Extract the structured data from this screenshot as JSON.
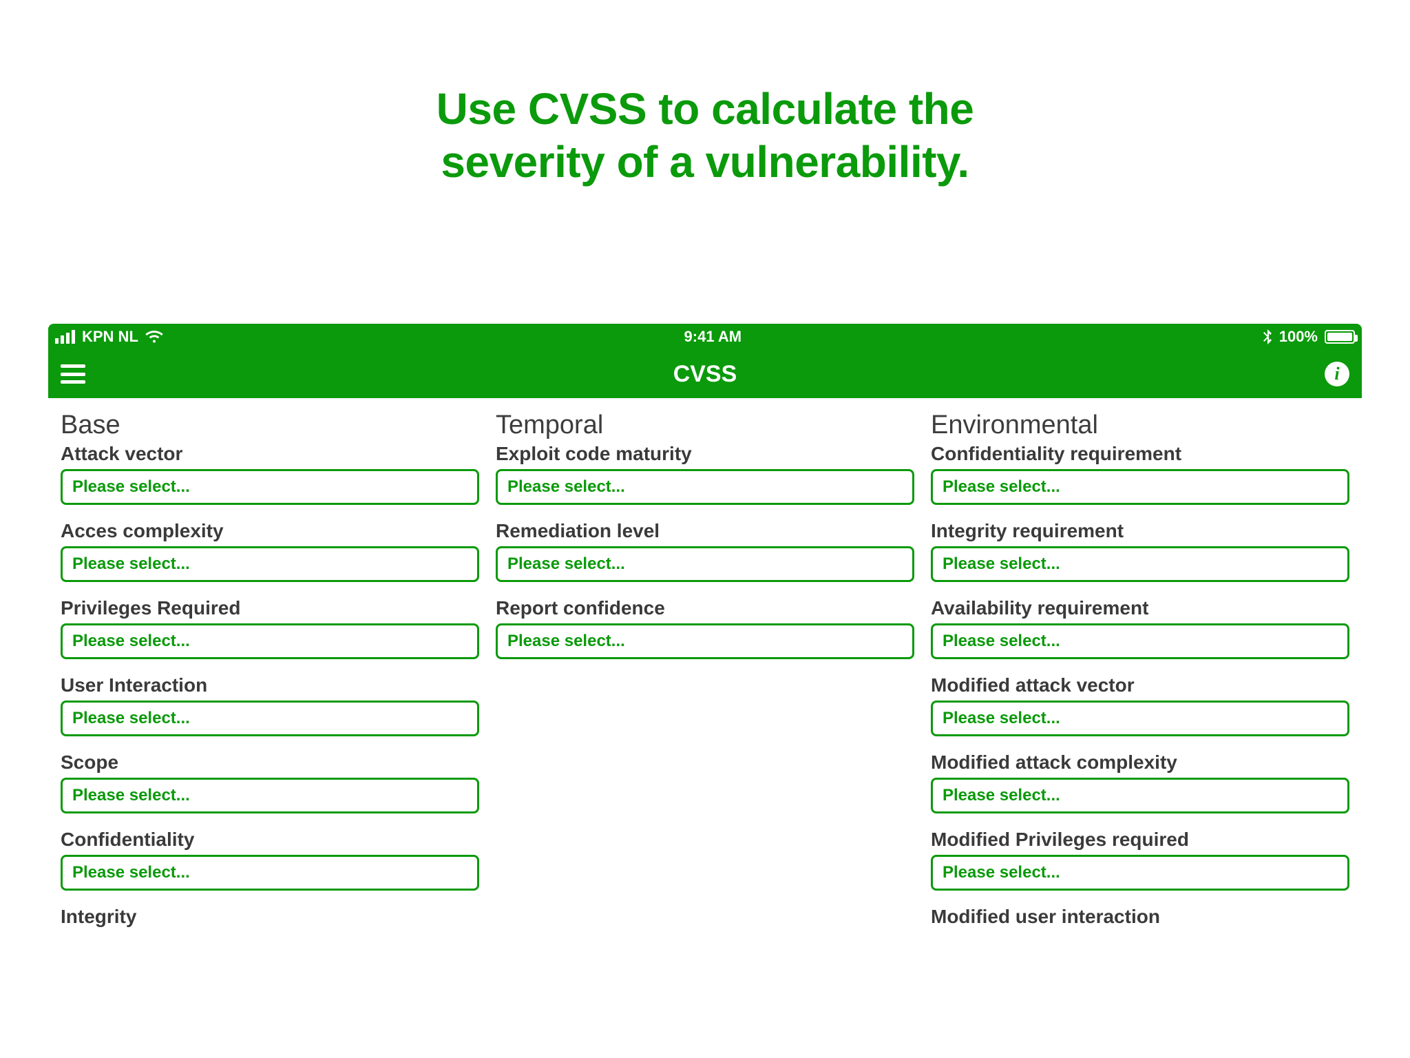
{
  "colors": {
    "brand": "#0b9a0b"
  },
  "promo": {
    "line1": "Use CVSS to calculate the",
    "line2": "severity of a vulnerability."
  },
  "status_bar": {
    "carrier": "KPN NL",
    "time": "9:41 AM",
    "battery_percent": "100%"
  },
  "nav": {
    "title": "CVSS"
  },
  "placeholder": "Please select...",
  "sections": {
    "base": {
      "title": "Base",
      "fields": [
        {
          "label": "Attack vector"
        },
        {
          "label": "Acces complexity"
        },
        {
          "label": "Privileges Required"
        },
        {
          "label": "User Interaction"
        },
        {
          "label": "Scope"
        },
        {
          "label": "Confidentiality"
        },
        {
          "label": "Integrity"
        }
      ]
    },
    "temporal": {
      "title": "Temporal",
      "fields": [
        {
          "label": "Exploit code maturity"
        },
        {
          "label": "Remediation level"
        },
        {
          "label": "Report confidence"
        }
      ]
    },
    "environmental": {
      "title": "Environmental",
      "fields": [
        {
          "label": "Confidentiality requirement"
        },
        {
          "label": "Integrity requirement"
        },
        {
          "label": "Availability requirement"
        },
        {
          "label": "Modified attack vector"
        },
        {
          "label": "Modified attack complexity"
        },
        {
          "label": "Modified Privileges required"
        },
        {
          "label": "Modified user interaction"
        }
      ]
    }
  }
}
